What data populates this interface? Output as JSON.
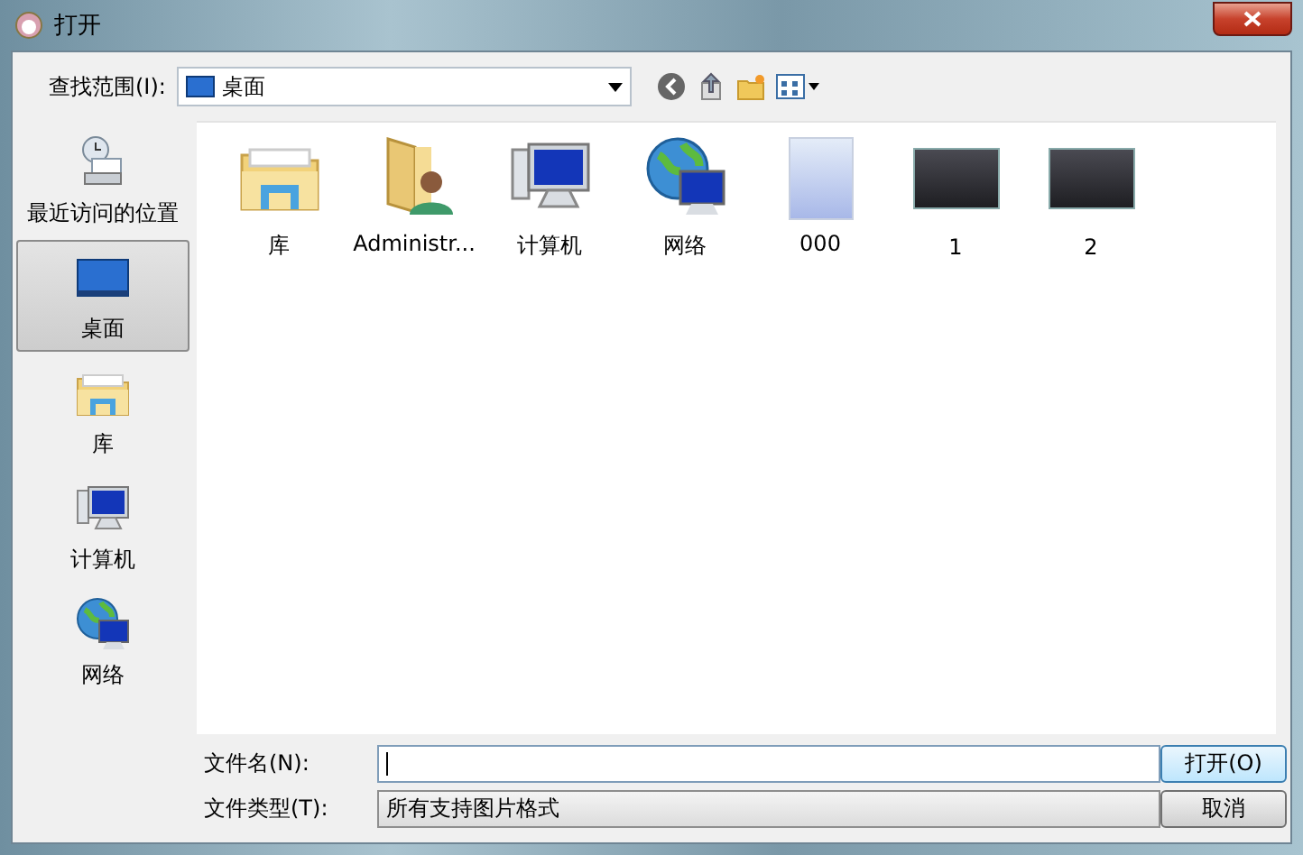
{
  "window": {
    "title": "打开"
  },
  "look_in": {
    "label": "查找范围(I):",
    "value": "桌面"
  },
  "sidebar": {
    "items": [
      {
        "label": "最近访问的位置",
        "kind": "recent",
        "selected": false
      },
      {
        "label": "桌面",
        "kind": "desktop",
        "selected": true
      },
      {
        "label": "库",
        "kind": "library",
        "selected": false
      },
      {
        "label": "计算机",
        "kind": "computer",
        "selected": false
      },
      {
        "label": "网络",
        "kind": "network",
        "selected": false
      }
    ]
  },
  "files": [
    {
      "name": "库",
      "kind": "library"
    },
    {
      "name": "Administr...",
      "kind": "user"
    },
    {
      "name": "计算机",
      "kind": "computer"
    },
    {
      "name": "网络",
      "kind": "network"
    },
    {
      "name": "000",
      "kind": "portrait"
    },
    {
      "name": "1",
      "kind": "screenshot"
    },
    {
      "name": "2",
      "kind": "screenshot"
    }
  ],
  "file_name": {
    "label": "文件名(N):"
  },
  "file_type": {
    "label": "文件类型(T):",
    "value": "所有支持图片格式"
  },
  "buttons": [
    {
      "label": "打开(O)",
      "kind": "primary"
    },
    {
      "label": "取消",
      "kind": "normal"
    }
  ]
}
